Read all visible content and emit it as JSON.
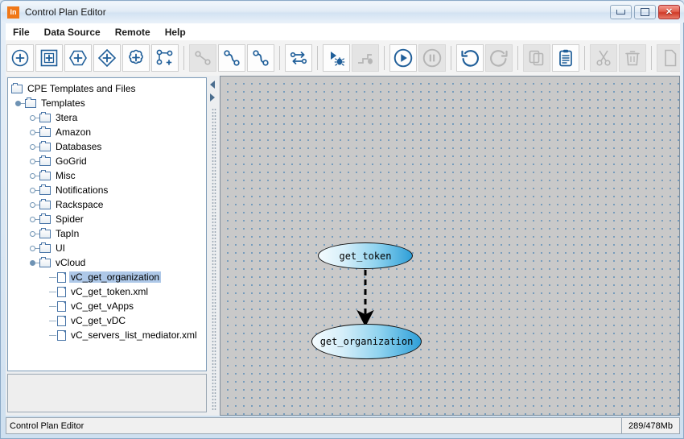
{
  "window": {
    "title": "Control Plan Editor",
    "app_icon": "in-logo-icon",
    "accent_orange": "#f07818",
    "controls": {
      "minimize": "minimize-icon",
      "maximize": "maximize-icon",
      "close": "✕"
    }
  },
  "menubar": {
    "items": [
      {
        "label": "File"
      },
      {
        "label": "Data Source"
      },
      {
        "label": "Remote"
      },
      {
        "label": "Help"
      }
    ]
  },
  "toolbar": {
    "buttons": [
      {
        "name": "add-circle-node-button",
        "icon": "circle-plus-icon",
        "enabled": true
      },
      {
        "name": "add-square-node-button",
        "icon": "square-plus-icon",
        "enabled": true
      },
      {
        "name": "add-hexagon-node-button",
        "icon": "hexagon-plus-icon",
        "enabled": true
      },
      {
        "name": "add-diamond-node-button",
        "icon": "diamond-plus-icon",
        "enabled": true
      },
      {
        "name": "add-gear-node-button",
        "icon": "gear-plus-icon",
        "enabled": true
      },
      {
        "name": "add-graph-node-button",
        "icon": "graph-plus-icon",
        "enabled": true
      },
      {
        "name": "link-nodes-button",
        "icon": "link-line-icon",
        "enabled": false
      },
      {
        "name": "curve-link-button",
        "icon": "curve-link-icon",
        "enabled": true
      },
      {
        "name": "curve-link-alt-button",
        "icon": "curve-link-alt-icon",
        "enabled": true
      },
      {
        "name": "swap-direction-button",
        "icon": "two-way-arrows-icon",
        "enabled": true
      },
      {
        "name": "debug-run-button",
        "icon": "play-bug-icon",
        "enabled": true
      },
      {
        "name": "step-debug-button",
        "icon": "step-bug-icon",
        "enabled": false
      },
      {
        "name": "run-button",
        "icon": "play-circle-icon",
        "enabled": true
      },
      {
        "name": "pause-button",
        "icon": "pause-circle-icon",
        "enabled": false
      },
      {
        "name": "undo-button",
        "icon": "undo-arrow-icon",
        "enabled": true
      },
      {
        "name": "redo-button",
        "icon": "redo-arrow-icon",
        "enabled": false
      },
      {
        "name": "copy-button",
        "icon": "copy-pages-icon",
        "enabled": false
      },
      {
        "name": "paste-button",
        "icon": "clipboard-icon",
        "enabled": true
      },
      {
        "name": "cut-button",
        "icon": "scissors-icon",
        "enabled": false
      },
      {
        "name": "delete-button",
        "icon": "trash-icon",
        "enabled": false
      },
      {
        "name": "extra-button",
        "icon": "page-icon",
        "enabled": false
      }
    ]
  },
  "tree": {
    "root": "CPE Templates and Files",
    "nodes": [
      {
        "label": "Templates",
        "type": "folder",
        "depth": 1,
        "expanded": true
      },
      {
        "label": "3tera",
        "type": "folder",
        "depth": 2,
        "expanded": false
      },
      {
        "label": "Amazon",
        "type": "folder",
        "depth": 2,
        "expanded": false
      },
      {
        "label": "Databases",
        "type": "folder",
        "depth": 2,
        "expanded": false
      },
      {
        "label": "GoGrid",
        "type": "folder",
        "depth": 2,
        "expanded": false
      },
      {
        "label": "Misc",
        "type": "folder",
        "depth": 2,
        "expanded": false
      },
      {
        "label": "Notifications",
        "type": "folder",
        "depth": 2,
        "expanded": false
      },
      {
        "label": "Rackspace",
        "type": "folder",
        "depth": 2,
        "expanded": false
      },
      {
        "label": "Spider",
        "type": "folder",
        "depth": 2,
        "expanded": false
      },
      {
        "label": "TapIn",
        "type": "folder",
        "depth": 2,
        "expanded": false
      },
      {
        "label": "UI",
        "type": "folder",
        "depth": 2,
        "expanded": false
      },
      {
        "label": "vCloud",
        "type": "folder",
        "depth": 2,
        "expanded": true
      },
      {
        "label": "vC_get_organization",
        "type": "file",
        "depth": 3,
        "selected": true
      },
      {
        "label": "vC_get_token.xml",
        "type": "file",
        "depth": 3,
        "selected": false
      },
      {
        "label": "vC_get_vApps",
        "type": "file",
        "depth": 3,
        "selected": false
      },
      {
        "label": "vC_get_vDC",
        "type": "file",
        "depth": 3,
        "selected": false
      },
      {
        "label": "vC_servers_list_mediator.xml",
        "type": "file",
        "depth": 3,
        "selected": false
      }
    ]
  },
  "splitter": {
    "collapse_left": "left-arrow-icon",
    "collapse_right": "right-arrow-icon"
  },
  "canvas": {
    "grid_color": "#5b8db8",
    "background": "#c9c9c9",
    "node_gradient_from": "#f4fbfe",
    "node_gradient_to": "#2f9fd8",
    "nodes": [
      {
        "id": "node-token",
        "label": "get_token"
      },
      {
        "id": "node-org",
        "label": "get_organization"
      }
    ],
    "edges": [
      {
        "from": "get_token",
        "to": "get_organization",
        "style": "dashed-arrow"
      }
    ]
  },
  "statusbar": {
    "message": "Control Plan Editor",
    "memory": "289/478Mb"
  }
}
